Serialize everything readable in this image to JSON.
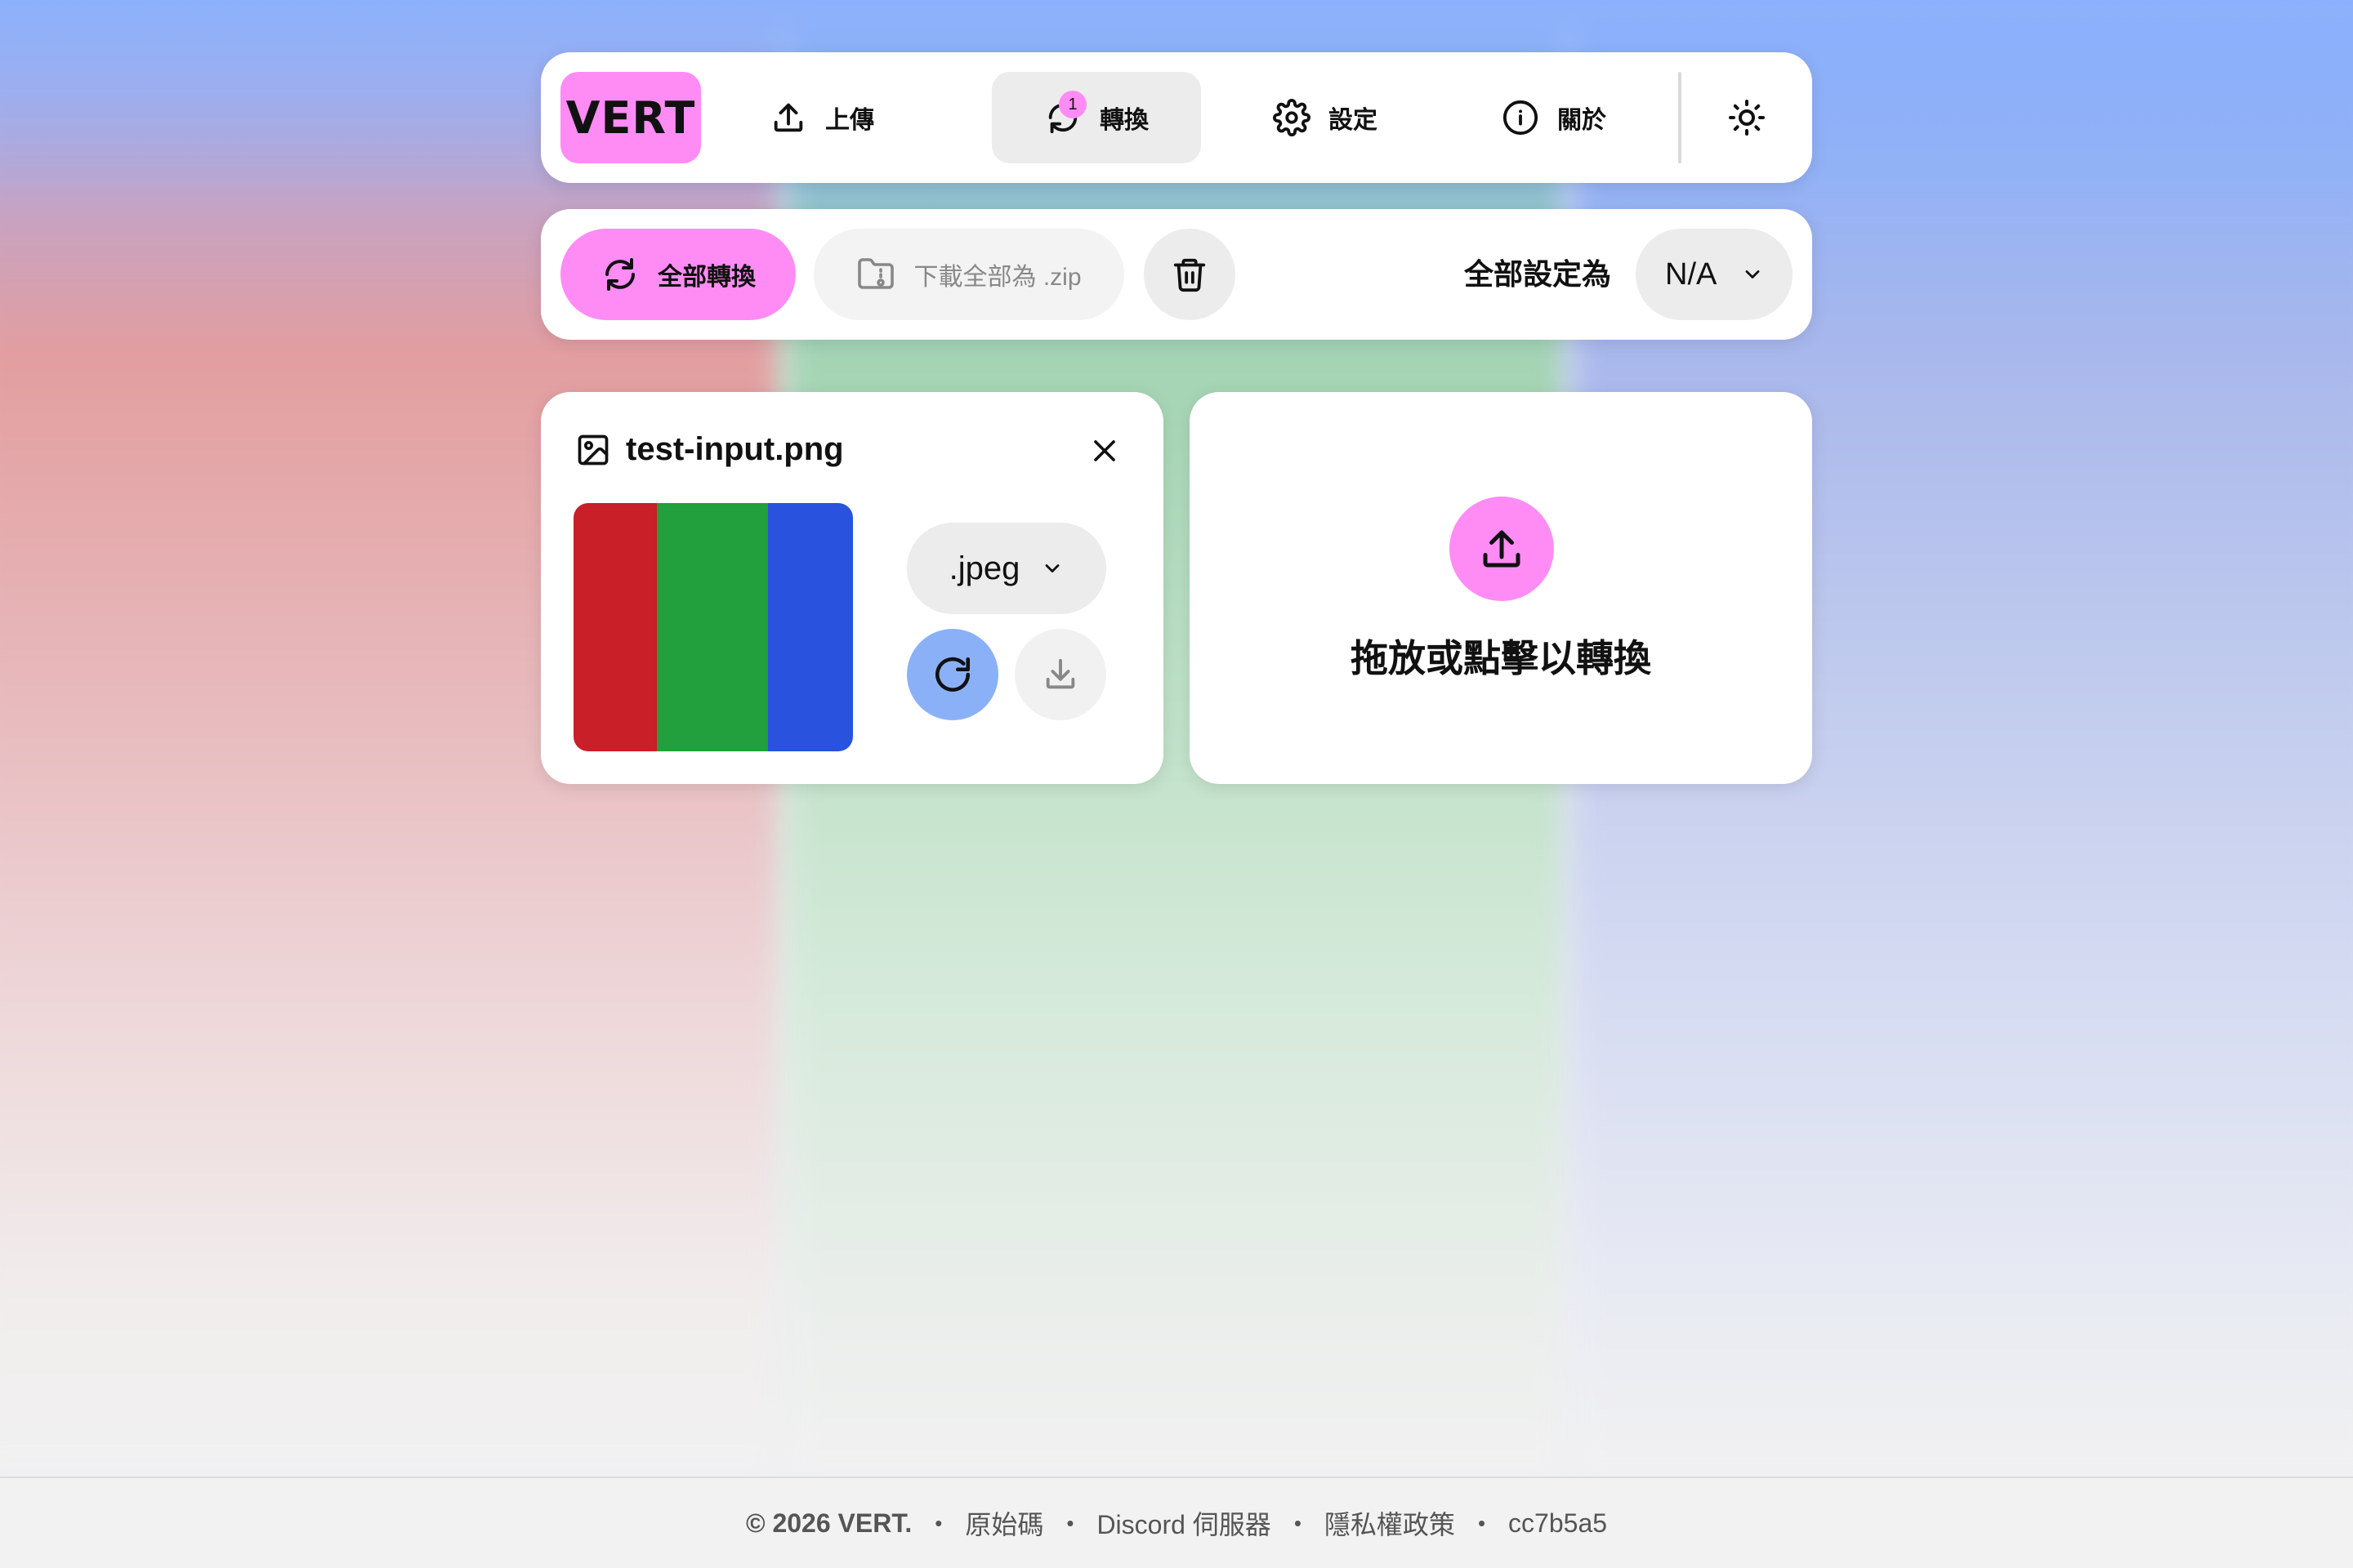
{
  "app": {
    "logo": "VERT"
  },
  "nav": {
    "upload": "上傳",
    "convert": "轉換",
    "convert_badge": "1",
    "settings": "設定",
    "about": "關於"
  },
  "toolbar": {
    "convert_all": "全部轉換",
    "download_zip": "下載全部為 .zip",
    "set_all_label": "全部設定為",
    "set_all_value": "N/A"
  },
  "file": {
    "name": "test-input.png",
    "format": ".jpeg",
    "thumbnail_colors": [
      "#c81f28",
      "#21a03d",
      "#2952de"
    ]
  },
  "dropzone": {
    "text": "拖放或點擊以轉換"
  },
  "footer": {
    "copyright": "© 2026 VERT.",
    "source": "原始碼",
    "discord": "Discord 伺服器",
    "privacy": "隱私權政策",
    "commit": "cc7b5a5",
    "separator": "•"
  },
  "colors": {
    "accent": "#ff8cf5",
    "convert_button": "#8ab1f8"
  }
}
